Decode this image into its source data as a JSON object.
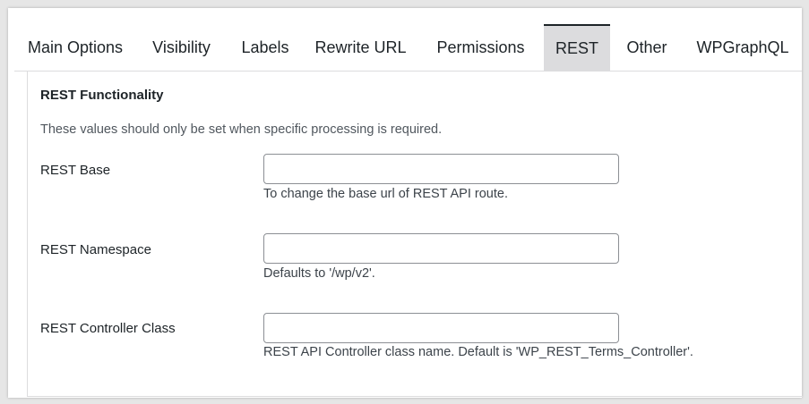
{
  "tabs": [
    {
      "label": "Main Options",
      "active": false
    },
    {
      "label": "Visibility",
      "active": false
    },
    {
      "label": "Labels",
      "active": false
    },
    {
      "label": "Rewrite URL",
      "active": false
    },
    {
      "label": "Permissions",
      "active": false
    },
    {
      "label": "REST",
      "active": true
    },
    {
      "label": "Other",
      "active": false
    },
    {
      "label": "WPGraphQL",
      "active": false
    }
  ],
  "section": {
    "title": "REST Functionality",
    "description": "These values should only be set when specific processing is required."
  },
  "fields": {
    "rest_base": {
      "label": "REST Base",
      "value": "",
      "help": "To change the base url of REST API route."
    },
    "rest_namespace": {
      "label": "REST Namespace",
      "value": "",
      "help": "Defaults to '/wp/v2'."
    },
    "rest_controller": {
      "label": "REST Controller Class",
      "value": "",
      "help": "REST API Controller class name. Default is 'WP_REST_Terms_Controller'."
    }
  },
  "colors": {
    "active_tab_bg": "#dcdcde",
    "border": "#8c8f94",
    "text": "#1d2327"
  }
}
